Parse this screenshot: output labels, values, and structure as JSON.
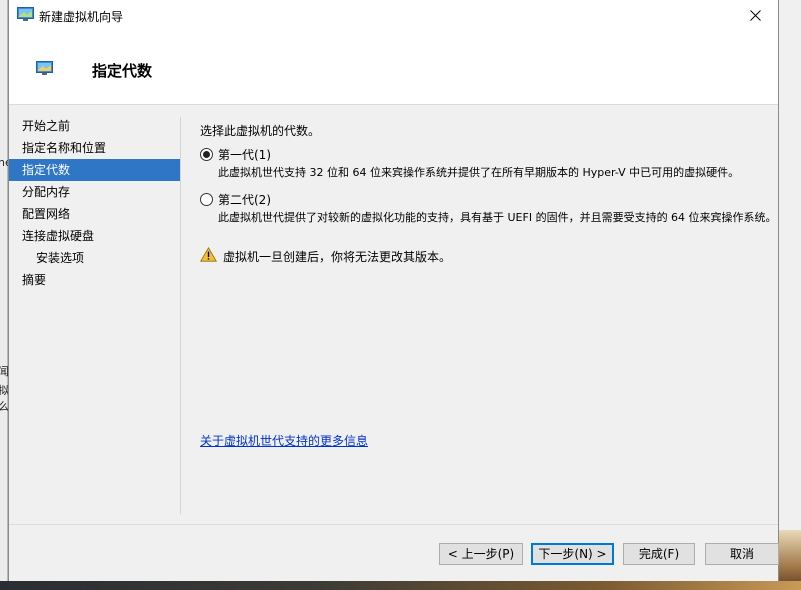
{
  "window": {
    "title": "新建虚拟机向导",
    "header_title": "指定代数",
    "icon": "hyperv-vm-icon"
  },
  "background": {
    "left_fragments": [
      "ne",
      "闻",
      "拟么"
    ]
  },
  "nav": {
    "items": [
      {
        "label": "开始之前",
        "selected": false,
        "sub": false
      },
      {
        "label": "指定名称和位置",
        "selected": false,
        "sub": false
      },
      {
        "label": "指定代数",
        "selected": true,
        "sub": false
      },
      {
        "label": "分配内存",
        "selected": false,
        "sub": false
      },
      {
        "label": "配置网络",
        "selected": false,
        "sub": false
      },
      {
        "label": "连接虚拟硬盘",
        "selected": false,
        "sub": false
      },
      {
        "label": "安装选项",
        "selected": false,
        "sub": true
      },
      {
        "label": "摘要",
        "selected": false,
        "sub": false
      }
    ]
  },
  "content": {
    "prompt": "选择此虚拟机的代数。",
    "options": [
      {
        "label": "第一代(1)",
        "checked": true,
        "description": "此虚拟机世代支持 32 位和 64 位来宾操作系统并提供了在所有早期版本的 Hyper-V 中已可用的虚拟硬件。"
      },
      {
        "label": "第二代(2)",
        "checked": false,
        "description": "此虚拟机世代提供了对较新的虚拟化功能的支持，具有基于 UEFI 的固件，并且需要受支持的 64 位来宾操作系统。"
      }
    ],
    "warning": "虚拟机一旦创建后，你将无法更改其版本。",
    "link": "关于虚拟机世代支持的更多信息"
  },
  "buttons": {
    "prev": "< 上一步(P)",
    "next": "下一步(N) >",
    "finish": "完成(F)",
    "cancel": "取消"
  },
  "colors": {
    "selection": "#2f76c6",
    "link": "#0033cc",
    "warning": "#f2c230"
  }
}
